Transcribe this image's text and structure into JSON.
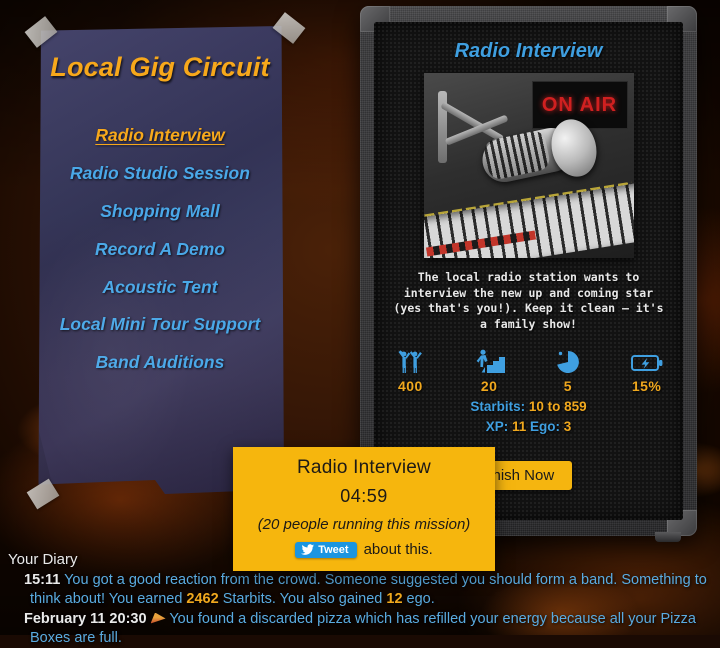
{
  "colors": {
    "accent_gold": "#f7a81b",
    "link_blue": "#4aa8e8",
    "popup_yellow": "#f6b60d",
    "twitter_blue": "#1b95e0",
    "background_brown": "#2e1305"
  },
  "poster": {
    "title": "Local Gig Circuit",
    "items": [
      {
        "label": "Radio Interview",
        "active": true
      },
      {
        "label": "Radio Studio Session",
        "active": false
      },
      {
        "label": "Shopping Mall",
        "active": false
      },
      {
        "label": "Record A Demo",
        "active": false
      },
      {
        "label": "Acoustic Tent",
        "active": false
      },
      {
        "label": "Local Mini Tour Support",
        "active": false
      },
      {
        "label": "Band Auditions",
        "active": false
      }
    ]
  },
  "mission": {
    "title": "Radio Interview",
    "image_sign_text": "ON AIR",
    "description": "The local radio station wants to interview the new up and coming star (yes that's you!). Keep it clean – it's a family show!",
    "stats": [
      {
        "icon": "fans-icon",
        "value": "400"
      },
      {
        "icon": "skill-level-icon",
        "value": "20"
      },
      {
        "icon": "duration-clock-icon",
        "value": "5"
      },
      {
        "icon": "energy-battery-icon",
        "value": "15%"
      }
    ],
    "starbits_label": "Starbits:",
    "starbits_value": "10 to 859",
    "xp_label": "XP:",
    "xp_value": "11",
    "ego_label": "Ego:",
    "ego_value": "3",
    "finish_button": "Finish Now"
  },
  "popup": {
    "title": "Radio Interview",
    "timer": "04:59",
    "people": "(20 people running this mission)",
    "tweet_button": "Tweet",
    "share_suffix": "about this."
  },
  "diary": {
    "title": "Your Diary",
    "entries": [
      {
        "time": "15:11",
        "text_before": "You got a good reaction from the crowd. Someone suggested you should form a band. Something to think about! You earned ",
        "amount": "2462",
        "text_mid": " Starbits. You also gained ",
        "amount2": "12",
        "text_after": " ego."
      },
      {
        "time": "February 11 20:30",
        "text_before": "You found a discarded pizza which has refilled your energy because all your Pizza Boxes are full.",
        "amount": "",
        "text_mid": "",
        "amount2": "",
        "text_after": ""
      }
    ]
  }
}
